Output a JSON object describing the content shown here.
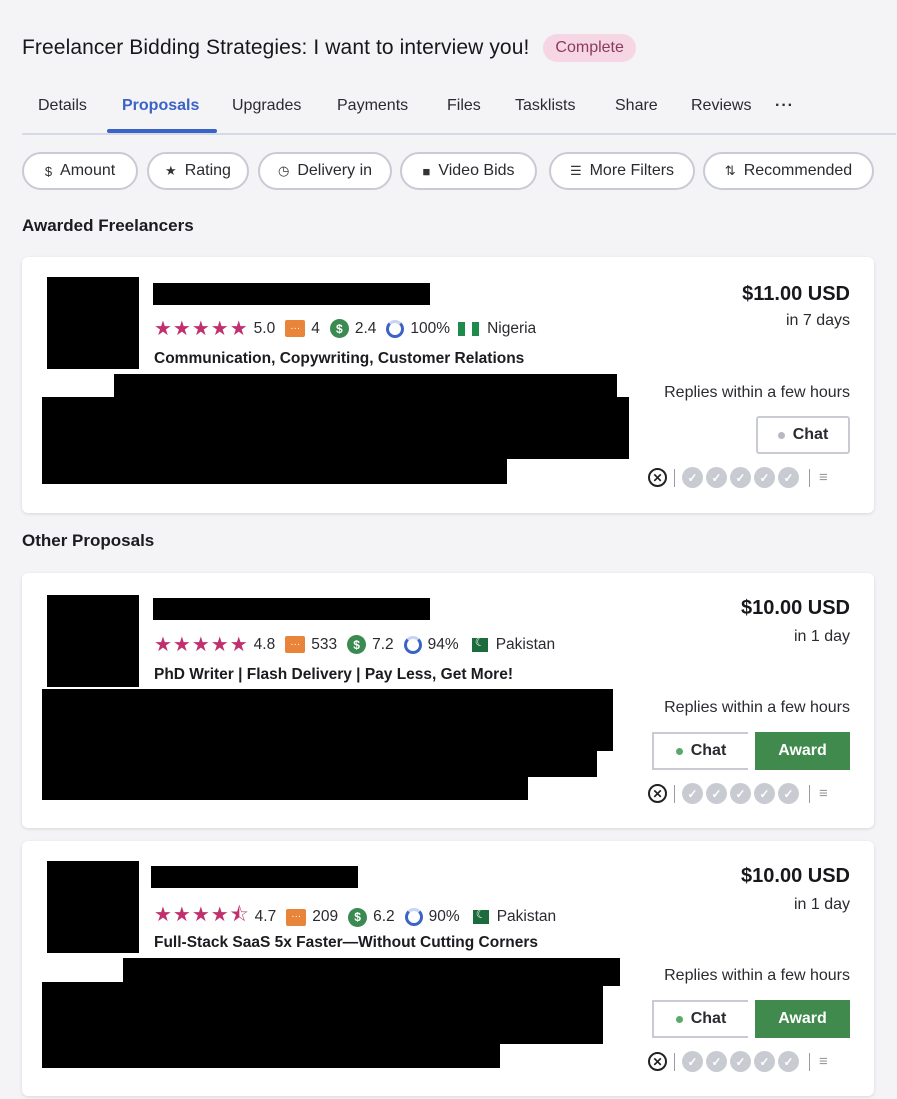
{
  "header": {
    "title": "Freelancer Bidding Strategies: I want to interview you!",
    "status_badge": "Complete"
  },
  "tabs": [
    {
      "label": "Details",
      "active": false
    },
    {
      "label": "Proposals",
      "active": true
    },
    {
      "label": "Upgrades",
      "active": false
    },
    {
      "label": "Payments",
      "active": false
    },
    {
      "label": "Files",
      "active": false
    },
    {
      "label": "Tasklists",
      "active": false
    },
    {
      "label": "Share",
      "active": false
    },
    {
      "label": "Reviews",
      "active": false
    }
  ],
  "tabs_more": "···",
  "filters": [
    {
      "label": "Amount",
      "icon": "dollar-icon",
      "glyph": "$"
    },
    {
      "label": "Rating",
      "icon": "star-icon",
      "glyph": "★"
    },
    {
      "label": "Delivery in",
      "icon": "clock-icon",
      "glyph": "◷"
    },
    {
      "label": "Video Bids",
      "icon": "video-icon",
      "glyph": "■"
    },
    {
      "label": "More Filters",
      "icon": "sliders-icon",
      "glyph": "☰"
    },
    {
      "label": "Recommended",
      "icon": "sort-icon",
      "glyph": "⇅"
    }
  ],
  "sections": {
    "awarded": "Awarded Freelancers",
    "other": "Other Proposals"
  },
  "proposals": [
    {
      "stars": "★★★★★",
      "rating": "5.0",
      "reviews": "4",
      "earnings": "2.4",
      "completion": "100%",
      "country": "Nigeria",
      "flag": "ng",
      "tagline": "Communication, Copywriting, Customer Relations",
      "price": "$11.00 USD",
      "delivery": "in 7 days",
      "replies": "Replies within a few hours",
      "chat_label": "Chat",
      "award_label": null
    },
    {
      "stars": "★★★★★",
      "rating": "4.8",
      "reviews": "533",
      "earnings": "7.2",
      "completion": "94%",
      "country": "Pakistan",
      "flag": "pk",
      "tagline": "PhD Writer | Flash Delivery | Pay Less, Get More!",
      "price": "$10.00 USD",
      "delivery": "in 1 day",
      "replies": "Replies within a few hours",
      "chat_label": "Chat",
      "award_label": "Award"
    },
    {
      "stars": "★★★★⯪",
      "rating": "4.7",
      "reviews": "209",
      "earnings": "6.2",
      "completion": "90%",
      "country": "Pakistan",
      "flag": "pk",
      "tagline": "Full-Stack SaaS 5x Faster—Without Cutting Corners",
      "price": "$10.00 USD",
      "delivery": "in 1 day",
      "replies": "Replies within a few hours",
      "chat_label": "Chat",
      "award_label": "Award"
    }
  ],
  "colors": {
    "accent": "#3b63c6",
    "star": "#c0306f",
    "award_green": "#3f8a4c",
    "badge_bg": "#f6d6e3"
  }
}
